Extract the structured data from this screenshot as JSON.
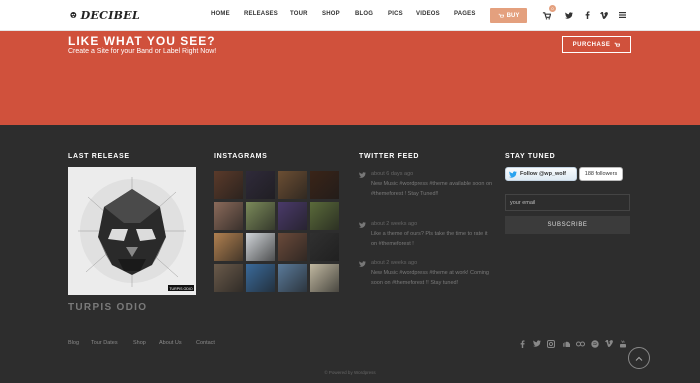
{
  "header": {
    "logo_text": "DECIBEL",
    "nav": [
      "HOME",
      "RELEASES",
      "TOUR",
      "SHOP",
      "BLOG",
      "PICS",
      "VIDEOS",
      "PAGES"
    ],
    "buy_label": "BUY",
    "cart_count": "0",
    "icons": [
      "cart-icon",
      "twitter-icon",
      "facebook-icon",
      "vimeo-icon",
      "menu-icon"
    ]
  },
  "hero": {
    "title": "LIKE WHAT YOU SEE?",
    "subtitle": "Create a Site for your Band or Label Right Now!",
    "purchase_label": "PURCHASE"
  },
  "widgets": {
    "last_release": {
      "title": "LAST RELEASE",
      "caption": "TURPIS ODIO",
      "art_tag": "TURPIS ODIO"
    },
    "instagrams": {
      "title": "INSTAGRAMS",
      "tiles": [
        "#5a3a2a",
        "#2f2a3a",
        "#6b4e33",
        "#3a2418",
        "#8a6a5a",
        "#7b8a5a",
        "#4a3a6a",
        "#5a6a3a",
        "#b08050",
        "#d0d4d8",
        "#6a4a3a",
        "#303030",
        "#6a5a4a",
        "#3a6a9a",
        "#5a7a9a",
        "#c0b8a0"
      ]
    },
    "twitter_feed": {
      "title": "TWITTER FEED",
      "tweets": [
        {
          "time": "about 6 days ago",
          "text": "New Music #wordpress #theme available soon on #themeforest ! Stay Tuned!!"
        },
        {
          "time": "about 2 weeks ago",
          "text": "Like a theme of ours? Pls take the time to rate it on #themeforest !"
        },
        {
          "time": "about 2 weeks ago",
          "text": "New Music #wordpress #theme at work! Coming soon on #themeforest !! Stay tuned!"
        }
      ]
    },
    "stay_tuned": {
      "title": "STAY TUNED",
      "follow_label": "Follow @wp_wolf",
      "followers": "188 followers",
      "email_placeholder": "your email",
      "subscribe_label": "SUBSCRIBE"
    }
  },
  "footer": {
    "links": [
      "Blog",
      "Tour Dates",
      "Shop",
      "About Us",
      "Contact"
    ],
    "social_icons": [
      "facebook-icon",
      "twitter-icon",
      "instagram-icon",
      "soundcloud-icon",
      "lastfm-icon",
      "spotify-icon",
      "vimeo-icon",
      "youtube-icon"
    ],
    "powered": "© Powered by Wordpress"
  },
  "colors": {
    "accent": "#d0513c",
    "buy": "#e4a07e",
    "footer_bg": "#2d2d2d"
  }
}
